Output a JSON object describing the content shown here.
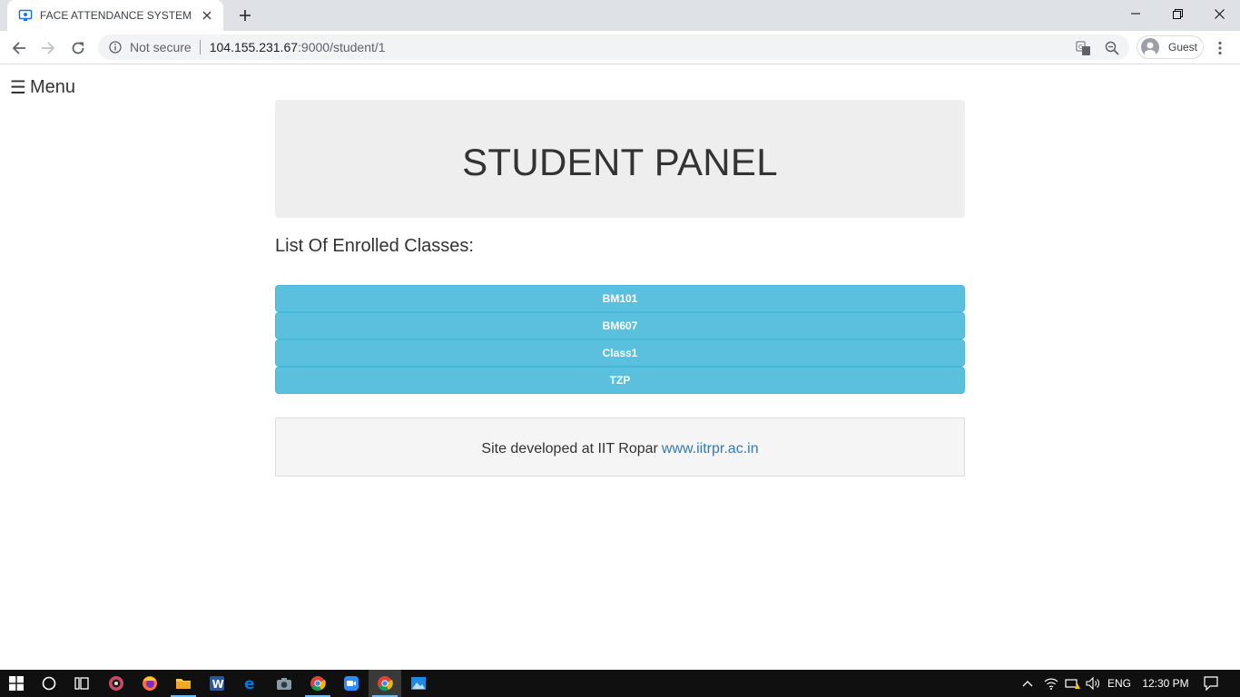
{
  "browser": {
    "tab_title": "FACE ATTENDANCE SYSTEM",
    "security_label": "Not secure",
    "url_host": "104.155.231.67",
    "url_path": ":9000/student/1",
    "profile_label": "Guest"
  },
  "page": {
    "menu_label": "Menu",
    "menu_icon": "☰",
    "panel_title": "STUDENT PANEL",
    "list_heading": "List Of Enrolled Classes:",
    "classes": [
      {
        "label": "BM101"
      },
      {
        "label": "BM607"
      },
      {
        "label": "Class1"
      },
      {
        "label": "TZP"
      }
    ],
    "footer_text": "Site developed at IIT Ropar",
    "footer_link": "www.iitrpr.ac.in"
  },
  "taskbar": {
    "language": "ENG",
    "time": "12:30 PM"
  },
  "colors": {
    "class_button": "#5bc0de",
    "jumbotron": "#eeeeee",
    "footer_link": "#337ab7",
    "taskbar": "#101010"
  }
}
